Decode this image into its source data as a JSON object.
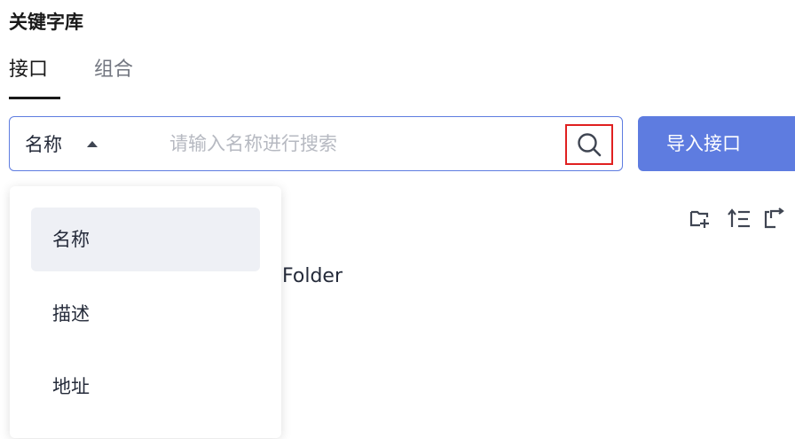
{
  "header": {
    "title": "关键字库"
  },
  "tabs": [
    {
      "label": "接口",
      "active": true
    },
    {
      "label": "组合",
      "active": false
    }
  ],
  "search": {
    "field_selected": "名称",
    "placeholder": "请输入名称进行搜索",
    "value": "",
    "search_icon": "search-icon"
  },
  "actions": {
    "import_label": "导入接口"
  },
  "dropdown": {
    "options": [
      {
        "label": "名称",
        "selected": true
      },
      {
        "label": "描述",
        "selected": false
      },
      {
        "label": "地址",
        "selected": false
      }
    ]
  },
  "tree": {
    "folder_label": "Folder"
  },
  "toolbar": {
    "icons": [
      "new-folder-icon",
      "collapse-all-icon",
      "refresh-icon"
    ]
  },
  "colors": {
    "primary": "#5e7ce0",
    "highlight_box": "#e02020",
    "selected_option_bg": "#eef0f5",
    "placeholder": "#b6b9c1"
  }
}
